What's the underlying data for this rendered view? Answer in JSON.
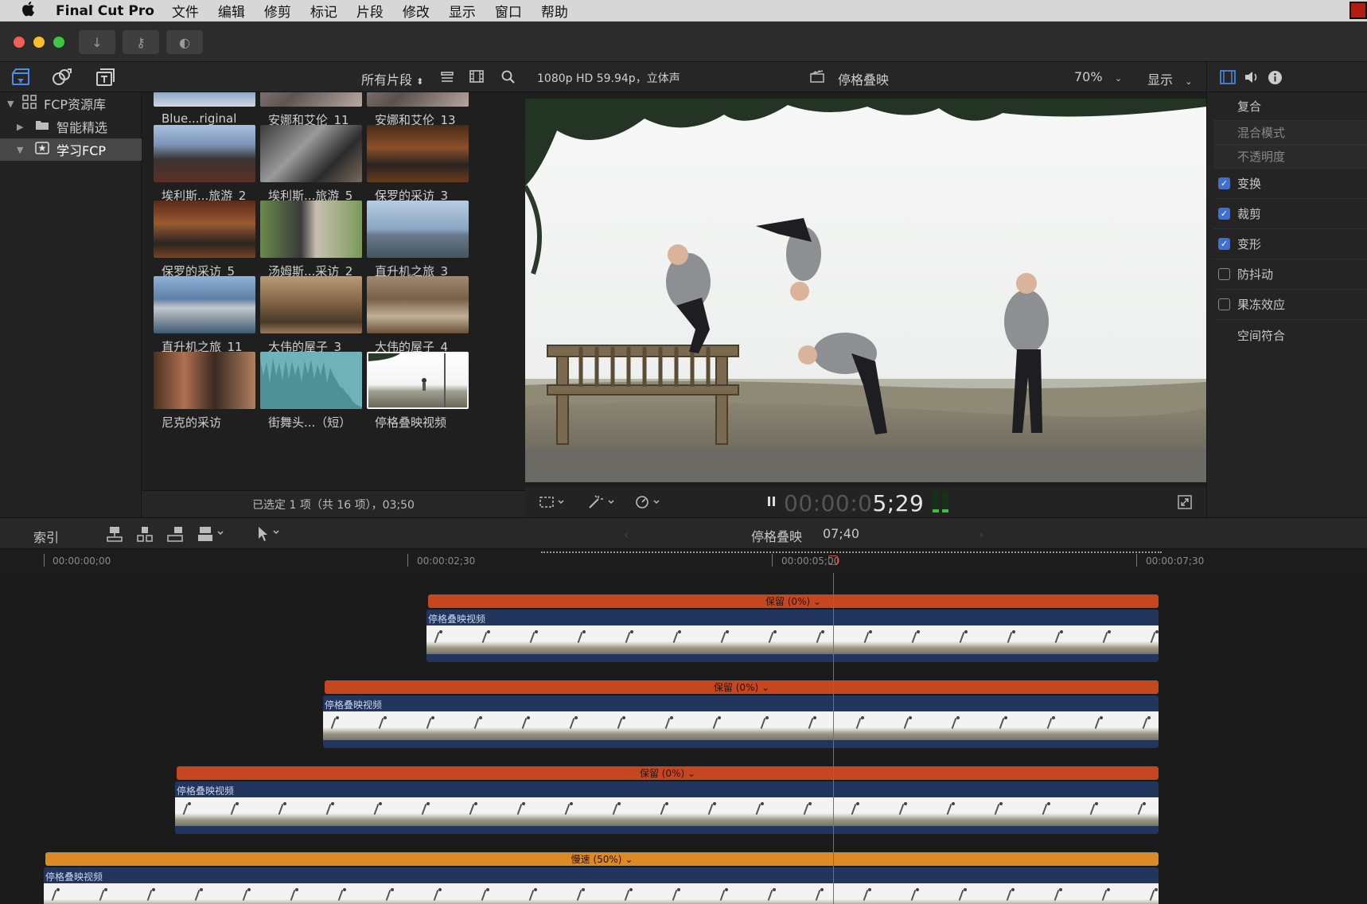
{
  "menubar": {
    "apple": "",
    "app_name": "Final Cut Pro",
    "items": [
      "文件",
      "编辑",
      "修剪",
      "标记",
      "片段",
      "修改",
      "显示",
      "窗口",
      "帮助"
    ]
  },
  "toolbar": {
    "import_icon": "↓",
    "keyword_icon": "⚷",
    "color_icon": "◐"
  },
  "browser": {
    "filter_label": "所有片段",
    "footer": "已选定 1 项（共 16 项），03;50",
    "library": {
      "items": [
        {
          "label": "FCP资源库",
          "icon": "grid-icon"
        },
        {
          "label": "智能精选",
          "icon": "folder-icon"
        },
        {
          "label": "学习FCP",
          "icon": "star-event-icon"
        }
      ]
    },
    "clips": [
      {
        "label": "Blue...riginal"
      },
      {
        "label": "安娜和艾伦_11"
      },
      {
        "label": "安娜和艾伦_13"
      },
      {
        "label": "埃利斯...旅游_2"
      },
      {
        "label": "埃利斯...旅游_5"
      },
      {
        "label": "保罗的采访_3"
      },
      {
        "label": "保罗的采访_5"
      },
      {
        "label": "汤姆斯...采访_2"
      },
      {
        "label": "直升机之旅_3"
      },
      {
        "label": "直升机之旅_11"
      },
      {
        "label": "大伟的屋子_3"
      },
      {
        "label": "大伟的屋子_4"
      },
      {
        "label": "尼克的采访"
      },
      {
        "label": "街舞头...（短）"
      },
      {
        "label": "停格叠映视频"
      }
    ]
  },
  "viewer": {
    "format": "1080p HD 59.94p，立体声",
    "clip_name": "停格叠映",
    "zoom": "70%",
    "display_menu": "显示",
    "timecode_dim": "00:00:0",
    "timecode_bright": "5;29"
  },
  "inspector": {
    "rows": [
      {
        "label": "复合",
        "checkbox": null
      },
      {
        "label": "混合模式",
        "checkbox": null
      },
      {
        "label": "不透明度",
        "checkbox": null
      },
      {
        "label": "变换",
        "checkbox": true
      },
      {
        "label": "裁剪",
        "checkbox": true
      },
      {
        "label": "变形",
        "checkbox": true
      },
      {
        "label": "防抖动",
        "checkbox": false
      },
      {
        "label": "果冻效应",
        "checkbox": false
      },
      {
        "label": "空间符合",
        "checkbox": null
      }
    ]
  },
  "timeline": {
    "index_label": "索引",
    "project_name": "停格叠映",
    "duration": "07;40",
    "ruler": [
      "00:00:00;00",
      "00:00:02;30",
      "00:00:05;00",
      "00:00:07;30"
    ],
    "tracks": [
      {
        "retime": "保留 (0%)",
        "clip": "停格叠映视频"
      },
      {
        "retime": "保留 (0%)",
        "clip": "停格叠映视频"
      },
      {
        "retime": "保留 (0%)",
        "clip": "停格叠映视频"
      },
      {
        "retime": "慢速 (50%)",
        "clip": "停格叠映视频"
      }
    ]
  },
  "colors": {
    "accent": "#3d6fd4",
    "retime_hold": "#c6471f",
    "retime_slow": "#dc8a25",
    "clip_blue": "#22355c",
    "playhead": "#d24a3a"
  }
}
